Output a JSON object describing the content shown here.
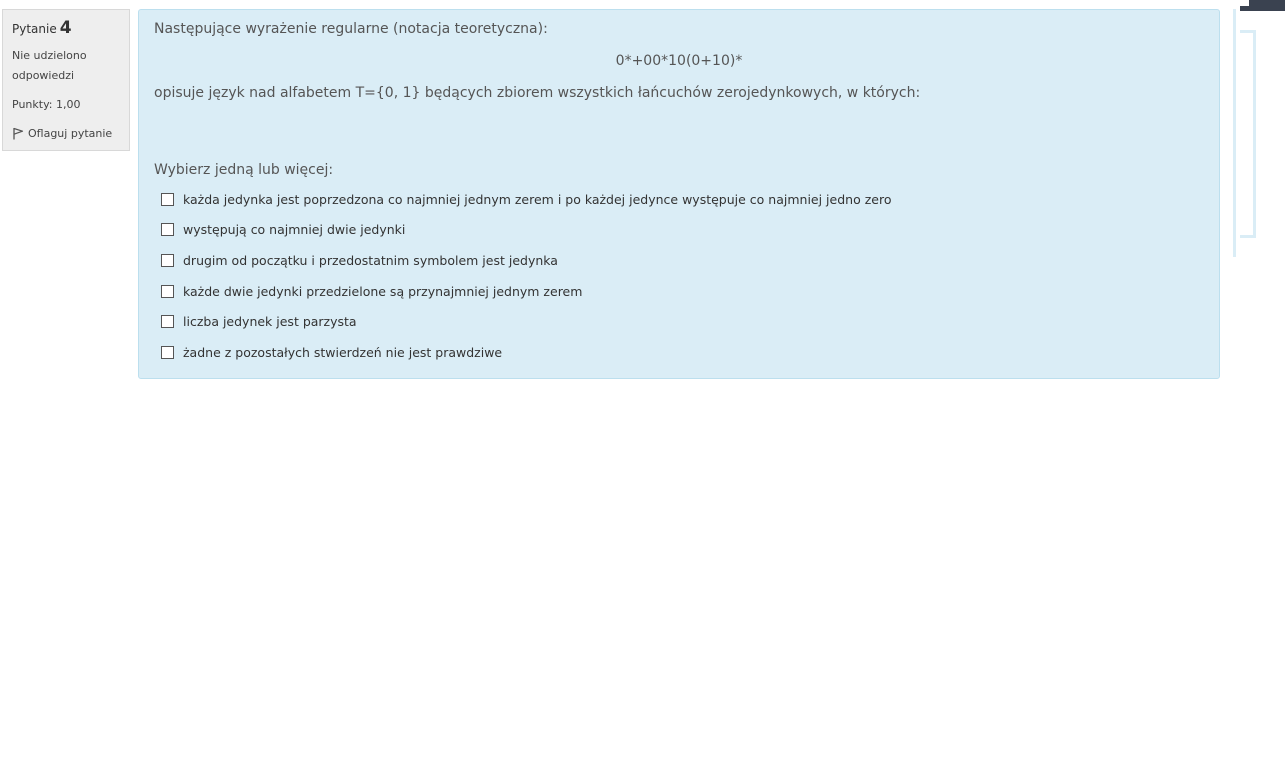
{
  "question_info": {
    "label": "Pytanie",
    "number": "4",
    "state_line1": "Nie udzielono",
    "state_line2": "odpowiedzi",
    "grade": "Punkty: 1,00",
    "flag_label": "Oflaguj pytanie"
  },
  "question": {
    "line1": "Następujące wyrażenie regularne (notacja teoretyczna):",
    "formula": "0*+00*10(0+10)*",
    "line2": "opisuje język nad alfabetem T={0, 1} będących zbiorem wszystkich łańcuchów zerojedynkowych, w których:",
    "prompt": "Wybierz jedną lub więcej:",
    "answers": [
      {
        "label": "każda jedynka jest poprzedzona co najmniej jednym zerem i po każdej jedynce występuje co najmniej jedno zero",
        "checked": false
      },
      {
        "label": "występują co najmniej dwie jedynki",
        "checked": false
      },
      {
        "label": "drugim od początku i przedostatnim symbolem jest jedynka",
        "checked": false
      },
      {
        "label": "każde dwie jedynki przedzielone są przynajmniej jednym zerem",
        "checked": false
      },
      {
        "label": "liczba jedynek jest parzysta",
        "checked": false
      },
      {
        "label": "żadne z pozostałych stwierdzeń nie jest prawdziwe",
        "checked": false
      }
    ]
  },
  "colors": {
    "content_bg": "#daedf6",
    "content_border": "#bcdfee",
    "info_bg": "#eeeeee",
    "corner": "#3a4250"
  },
  "icons": {
    "flag": "flag-icon"
  }
}
